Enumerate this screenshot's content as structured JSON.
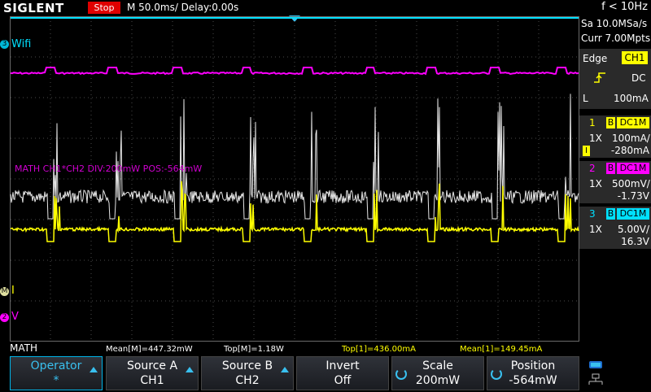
{
  "header": {
    "brand": "SIGLENT",
    "run_state": "Stop",
    "timebase": "M 50.0ms/ Delay:0.00s",
    "frequency": "f < 10Hz"
  },
  "acquisition": {
    "sample_rate": "Sa 10.0MSa/s",
    "memory": "Curr 7.00Mpts"
  },
  "trigger": {
    "type": "Edge",
    "source": "CH1",
    "coupling": "DC",
    "level_prefix": "L",
    "level": "100mA"
  },
  "channels": [
    {
      "num": "1",
      "bw": "B",
      "coupling": "DC1M",
      "probe": "1X",
      "scale": "100mA/",
      "offset": "-280mA",
      "color": "#ffff00",
      "marker": "I"
    },
    {
      "num": "2",
      "bw": "B",
      "coupling": "DC1M",
      "probe": "1X",
      "scale": "500mV/",
      "offset": "-1.73V",
      "color": "#ff00ff"
    },
    {
      "num": "3",
      "bw": "B",
      "coupling": "DC1M",
      "probe": "1X",
      "scale": "5.00V/",
      "offset": "16.3V",
      "color": "#00e0ff"
    }
  ],
  "waveform_labels": {
    "ch3_num": "3",
    "ch3_name": "Wifi",
    "ch1_name": "I",
    "ch2_num": "2",
    "ch2_name": "V",
    "ch1_marker": "M",
    "math_text": "MATH  CH1*CH2  DIV:200mW  POS:-564mW"
  },
  "measurements": {
    "source_label": "MATH",
    "mean_m": "Mean[M]=447.32mW",
    "top_m": "Top[M]=1.18W",
    "top_1": "Top[1]=436.00mA",
    "mean_1": "Mean[1]=149.45mA"
  },
  "softkeys": [
    {
      "l1": "Operator",
      "l2": "*",
      "active": true
    },
    {
      "l1": "Source A",
      "l2": "CH1"
    },
    {
      "l1": "Source B",
      "l2": "CH2"
    },
    {
      "l1": "Invert",
      "l2": "Off"
    },
    {
      "l1": "Scale",
      "l2": "200mW"
    },
    {
      "l1": "Position",
      "l2": "-564mW"
    }
  ],
  "colors": {
    "ch1": "#ffff00",
    "ch2": "#ff00ff",
    "ch3": "#00e0ff",
    "math": "#e6e6e6",
    "accent": "#39c0ef",
    "stop": "#e00000"
  }
}
